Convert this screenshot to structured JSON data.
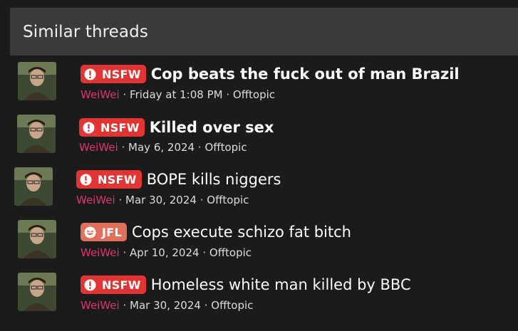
{
  "panel": {
    "title": "Similar threads"
  },
  "threads": [
    {
      "badge": "NSFW",
      "title": "Cop beats the fuck out of man Brazil",
      "author": "WeiWei",
      "date": "Friday at 1:08 PM",
      "forum": "Offtopic"
    },
    {
      "badge": "NSFW",
      "title": "Killed over sex",
      "author": "WeiWei",
      "date": "May 6, 2024",
      "forum": "Offtopic"
    },
    {
      "badge": "NSFW",
      "title": "BOPE kills niggers",
      "author": "WeiWei",
      "date": "Mar 30, 2024",
      "forum": "Offtopic"
    },
    {
      "badge": "JFL",
      "title": "Cops execute schizo fat bitch",
      "author": "WeiWei",
      "date": "Apr 10, 2024",
      "forum": "Offtopic"
    },
    {
      "badge": "NSFW",
      "title": "Homeless white man killed by BBC",
      "author": "WeiWei",
      "date": "Mar 30, 2024",
      "forum": "Offtopic"
    }
  ],
  "colors": {
    "nsfw": "#e33434",
    "jfl": "#e0705a",
    "author": "#d9366b",
    "header_bg": "#3a3a3a",
    "page_bg": "#1b1b1b"
  },
  "icons": {
    "nsfw": "alert-circle-icon",
    "jfl": "laughing-face-icon"
  },
  "sep": "·"
}
